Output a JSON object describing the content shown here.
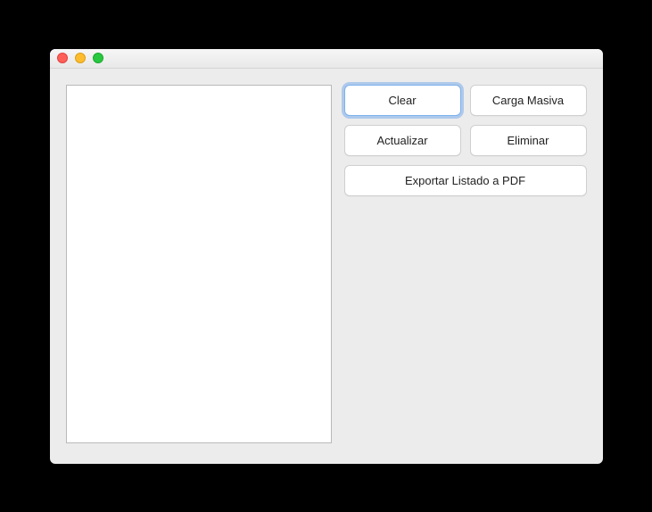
{
  "buttons": {
    "clear": "Clear",
    "carga_masiva": "Carga Masiva",
    "actualizar": "Actualizar",
    "eliminar": "Eliminar",
    "exportar_pdf": "Exportar Listado a PDF"
  }
}
